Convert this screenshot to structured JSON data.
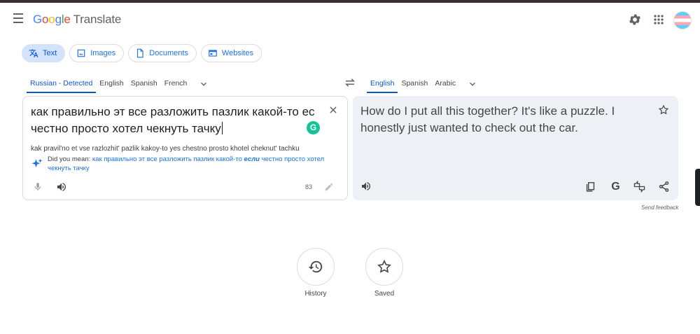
{
  "header": {
    "logo": {
      "g1": "G",
      "g2": "o",
      "g3": "o",
      "g4": "g",
      "g5": "l",
      "g6": "e"
    },
    "app_name": "Translate",
    "icons": [
      "menu-icon",
      "gear-icon",
      "apps-grid-icon",
      "avatar"
    ]
  },
  "modes": [
    {
      "label": "Text",
      "icon": "translate-icon",
      "active": true
    },
    {
      "label": "Images",
      "icon": "image-icon"
    },
    {
      "label": "Documents",
      "icon": "document-icon"
    },
    {
      "label": "Websites",
      "icon": "website-icon"
    }
  ],
  "source_langs": [
    "Russian - Detected",
    "English",
    "Spanish",
    "French"
  ],
  "target_langs": [
    "English",
    "Spanish",
    "Arabic"
  ],
  "source": {
    "text": "как правильно эт все разложить пазлик какой-то ес честно просто хотел чекнуть тачку",
    "transliteration": "kak pravil'no et vse razlozhit' pazlik kakoy-to yes chestno prosto khotel cheknut' tachku",
    "did_you_mean_label": "Did you mean: ",
    "suggestion_before": "как правильно эт все разложить пазлик какой-то ",
    "suggestion_bold": "если",
    "suggestion_after": " честно просто хотел чекнуть тачку",
    "char_count": "83",
    "grammarly_badge": "G"
  },
  "target": {
    "text": "How do I put all this together? It's like a puzzle. I honestly just wanted to check out the car.",
    "google_badge": "G"
  },
  "feedback_label": "Send feedback",
  "history_label": "History",
  "saved_label": "Saved",
  "colors": {
    "accent": "#0b57d0",
    "chip_active_bg": "#d3e3fd",
    "target_panel_bg": "#edf0f5"
  }
}
